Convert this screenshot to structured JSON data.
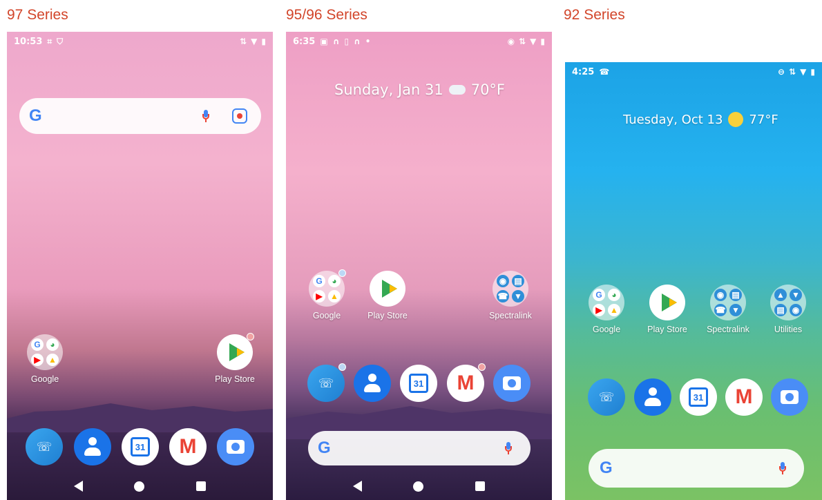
{
  "titles": {
    "p97": "97 Series",
    "p95": "95/96 Series",
    "p92": "92 Series"
  },
  "colors": {
    "title": "#d2452a"
  },
  "p97": {
    "time": "10:53",
    "apps": [
      {
        "label": "Google"
      },
      {
        "label": "Play Store"
      }
    ],
    "dock": {
      "calendar_day": "31",
      "gmail_letter": "M"
    },
    "icons": [
      "qr-icon",
      "shield-icon",
      "signal-icon",
      "wifi-icon",
      "battery-icon"
    ]
  },
  "p95": {
    "time": "6:35",
    "date": "Sunday, Jan 31",
    "temp": "70°F",
    "apps": [
      {
        "label": "Google"
      },
      {
        "label": "Play Store"
      },
      {
        "label": "Spectralink"
      }
    ],
    "dock": {
      "calendar_day": "31",
      "gmail_letter": "M"
    }
  },
  "p92": {
    "time": "4:25",
    "date": "Tuesday, Oct 13",
    "temp": "77°F",
    "apps": [
      {
        "label": "Google"
      },
      {
        "label": "Play Store"
      },
      {
        "label": "Spectralink"
      },
      {
        "label": "Utilities"
      }
    ],
    "dock": {
      "calendar_day": "31",
      "gmail_letter": "M"
    }
  },
  "google_letter": "G"
}
